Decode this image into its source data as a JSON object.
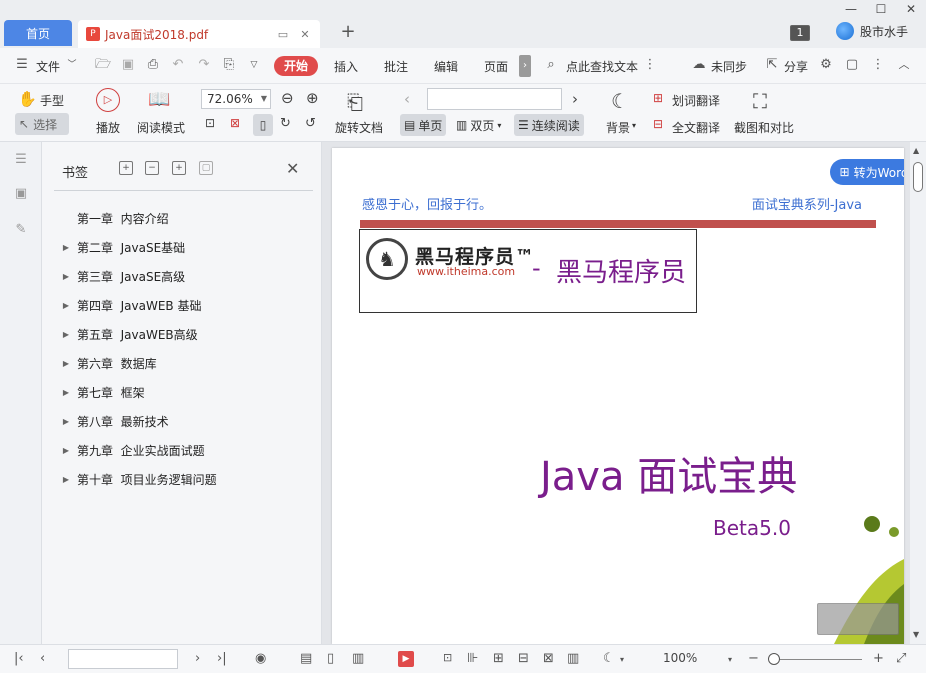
{
  "titlebar": {
    "home_tab": "首页",
    "doc_tab": "Java面试2018.pdf",
    "account_badge": "1",
    "user_name": "股市水手"
  },
  "menubar": {
    "file": "文件",
    "start": "开始",
    "insert": "插入",
    "annotate": "批注",
    "edit": "编辑",
    "page": "页面",
    "search": "点此查找文本",
    "sync": "未同步",
    "share": "分享"
  },
  "toolbar": {
    "hand": "手型",
    "select": "选择",
    "play": "播放",
    "read_mode": "阅读模式",
    "zoom": "72.06%",
    "rotate": "旋转文档",
    "single": "单页",
    "double": "双页",
    "continuous": "连续阅读",
    "background": "背景",
    "word_translate": "划词翻译",
    "full_translate": "全文翻译",
    "screenshot_compare": "截图和对比"
  },
  "bookmarks": {
    "title": "书签",
    "items": [
      {
        "label": "第一章  内容介绍",
        "expandable": false
      },
      {
        "label": "第二章  JavaSE基础",
        "expandable": true
      },
      {
        "label": "第三章  JavaSE高级",
        "expandable": true
      },
      {
        "label": "第四章  JavaWEB 基础",
        "expandable": true
      },
      {
        "label": "第五章  JavaWEB高级",
        "expandable": true
      },
      {
        "label": "第六章  数据库",
        "expandable": true
      },
      {
        "label": "第七章  框架",
        "expandable": true
      },
      {
        "label": "第八章  最新技术",
        "expandable": true
      },
      {
        "label": "第九章  企业实战面试题",
        "expandable": true
      },
      {
        "label": "第十章  项目业务逻辑问题",
        "expandable": true
      }
    ]
  },
  "document": {
    "convert_button": "转为Word",
    "header_left": "感恩于心，回报于行。",
    "header_right": "面试宝典系列-Java",
    "logo_cn": "黑马程序员™",
    "logo_url": "www.itheima.com",
    "logo_dash": "-",
    "logo_name": "黑马程序员",
    "title": "Java 面试宝典",
    "version": "Beta5.0",
    "colors": {
      "title": "#7a1e8c",
      "header": "#3d6fd1",
      "rule": "#c0504d"
    }
  },
  "statusbar": {
    "zoom": "100%"
  }
}
